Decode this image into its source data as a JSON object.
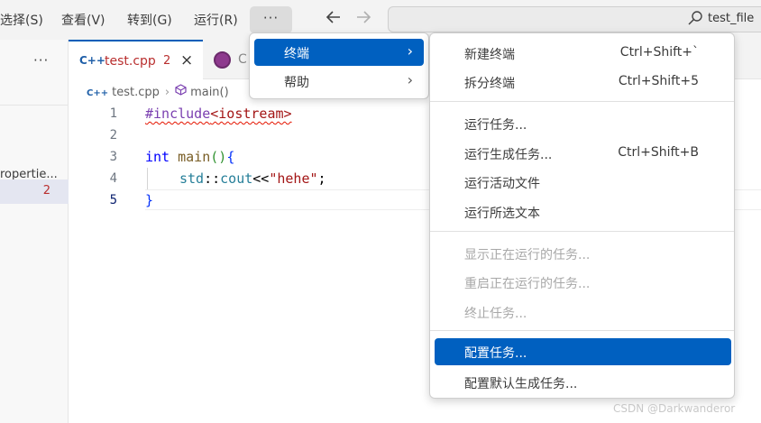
{
  "menubar": {
    "items": [
      "选择(S)",
      "查看(V)",
      "转到(G)",
      "运行(R)"
    ],
    "more_label": "···",
    "back_arrow": "arrow-left-icon",
    "forward_arrow": "arrow-right-icon",
    "search_label": "test_file"
  },
  "sidebar": {
    "more_label": "···",
    "item_label": "ropertie...",
    "problem_count": "2"
  },
  "tabs": [
    {
      "icon": "C++",
      "label": "test.cpp",
      "badge": "2",
      "close": "×"
    },
    {
      "label": "C"
    }
  ],
  "breadcrumb": {
    "file_icon": "C++",
    "file": "test.cpp",
    "symbol": "main()"
  },
  "editor": {
    "line_numbers": [
      "1",
      "2",
      "3",
      "4",
      "5"
    ],
    "line1": {
      "directive": "#include",
      "header": "<iostream>"
    },
    "line3": {
      "type": "int",
      "fn": " main",
      "paren": "()",
      "brace": "{"
    },
    "line4": {
      "ns": "std",
      "op1": "::",
      "obj": "cout",
      "op2": "<<",
      "str": "\"hehe\"",
      "end": ";"
    },
    "line5": {
      "brace": "}"
    }
  },
  "submenu_primary": [
    {
      "label": "终端",
      "arrow": "›",
      "active": true
    },
    {
      "label": "帮助",
      "arrow": "›",
      "active": false
    }
  ],
  "terminal_menu": {
    "new_terminal": {
      "label": "新建终端",
      "shortcut": "Ctrl+Shift+`"
    },
    "split_terminal": {
      "label": "拆分终端",
      "shortcut": "Ctrl+Shift+5"
    },
    "run_task": {
      "label": "运行任务..."
    },
    "run_build_task": {
      "label": "运行生成任务...",
      "shortcut": "Ctrl+Shift+B"
    },
    "run_active_file": {
      "label": "运行活动文件"
    },
    "run_selected_text": {
      "label": "运行所选文本"
    },
    "show_running": {
      "label": "显示正在运行的任务..."
    },
    "restart_running": {
      "label": "重启正在运行的任务..."
    },
    "terminate_task": {
      "label": "终止任务..."
    },
    "configure_tasks": {
      "label": "配置任务..."
    },
    "configure_default_build": {
      "label": "配置默认生成任务..."
    }
  },
  "watermark": "CSDN @Darkwanderor",
  "colors": {
    "accent": "#0060c0",
    "error": "#b92f2f",
    "tab_active_border": "#005fb8"
  }
}
